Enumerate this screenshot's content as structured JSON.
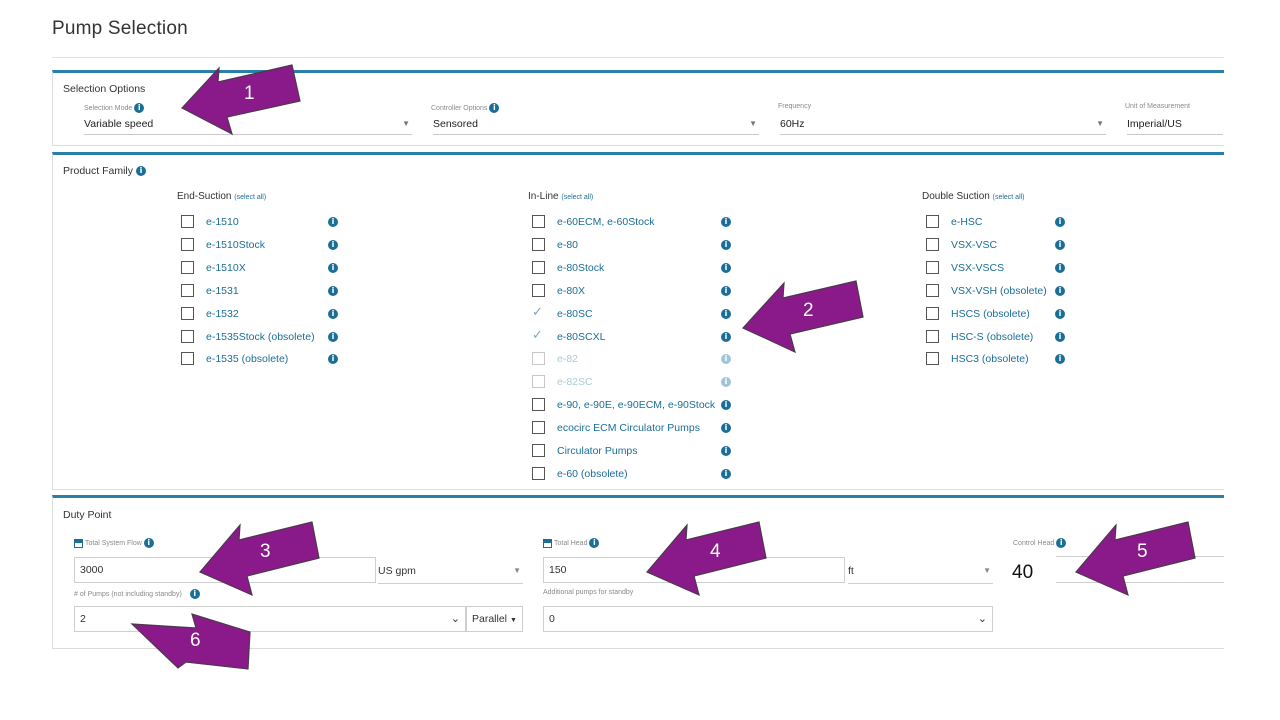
{
  "page": {
    "title": "Pump Selection"
  },
  "selection_options": {
    "title": "Selection Options",
    "selection_mode": {
      "label": "Selection Mode",
      "value": "Variable speed"
    },
    "controller_options": {
      "label": "Controller Options",
      "value": "Sensored"
    },
    "frequency": {
      "label": "Frequency",
      "value": "60Hz"
    },
    "unit_of_measurement": {
      "label": "Unit of Measurement",
      "value": "Imperial/US"
    }
  },
  "product_family": {
    "title": "Product Family",
    "select_all": "(select all)",
    "end_suction": {
      "heading": "End-Suction",
      "items": [
        {
          "label": "e-1510",
          "state": "unchecked"
        },
        {
          "label": "e-1510Stock",
          "state": "unchecked"
        },
        {
          "label": "e-1510X",
          "state": "unchecked"
        },
        {
          "label": "e-1531",
          "state": "unchecked"
        },
        {
          "label": "e-1532",
          "state": "unchecked"
        },
        {
          "label": "e-1535Stock (obsolete)",
          "state": "unchecked"
        },
        {
          "label": "e-1535 (obsolete)",
          "state": "unchecked"
        }
      ]
    },
    "in_line": {
      "heading": "In-Line",
      "items": [
        {
          "label": "e-60ECM, e-60Stock",
          "state": "unchecked"
        },
        {
          "label": "e-80",
          "state": "unchecked"
        },
        {
          "label": "e-80Stock",
          "state": "unchecked"
        },
        {
          "label": "e-80X",
          "state": "unchecked"
        },
        {
          "label": "e-80SC",
          "state": "checked"
        },
        {
          "label": "e-80SCXL",
          "state": "checked"
        },
        {
          "label": "e-82",
          "state": "disabled"
        },
        {
          "label": "e-82SC",
          "state": "disabled"
        },
        {
          "label": "e-90, e-90E, e-90ECM, e-90Stock",
          "state": "unchecked"
        },
        {
          "label": "ecocirc ECM Circulator Pumps",
          "state": "unchecked"
        },
        {
          "label": "Circulator Pumps",
          "state": "unchecked"
        },
        {
          "label": "e-60 (obsolete)",
          "state": "unchecked"
        }
      ]
    },
    "double_suction": {
      "heading": "Double Suction",
      "items": [
        {
          "label": "e-HSC",
          "state": "unchecked"
        },
        {
          "label": "VSX-VSC",
          "state": "unchecked"
        },
        {
          "label": "VSX-VSCS",
          "state": "unchecked"
        },
        {
          "label": "VSX-VSH (obsolete)",
          "state": "unchecked"
        },
        {
          "label": "HSCS (obsolete)",
          "state": "unchecked"
        },
        {
          "label": "HSC-S (obsolete)",
          "state": "unchecked"
        },
        {
          "label": "HSC3 (obsolete)",
          "state": "unchecked"
        }
      ]
    }
  },
  "duty_point": {
    "title": "Duty Point",
    "total_system_flow": {
      "label": "Total System Flow",
      "value": "3000",
      "unit": "US gpm"
    },
    "total_head": {
      "label": "Total Head",
      "value": "150",
      "unit": "ft"
    },
    "control_head": {
      "label": "Control Head",
      "value": "40"
    },
    "num_pumps": {
      "label": "# of Pumps (not including standby)",
      "value": "2",
      "arrangement": "Parallel"
    },
    "standby_pumps": {
      "label": "Additional pumps for standby",
      "value": "0"
    }
  },
  "annotations": {
    "arrow_1": "1",
    "arrow_2": "2",
    "arrow_3": "3",
    "arrow_4": "4",
    "arrow_5": "5",
    "arrow_6": "6",
    "color": "#8a1a8a"
  },
  "colors": {
    "accent": "#2a7fa6",
    "link": "#1b6e96",
    "annotation": "#8a1a8a"
  }
}
